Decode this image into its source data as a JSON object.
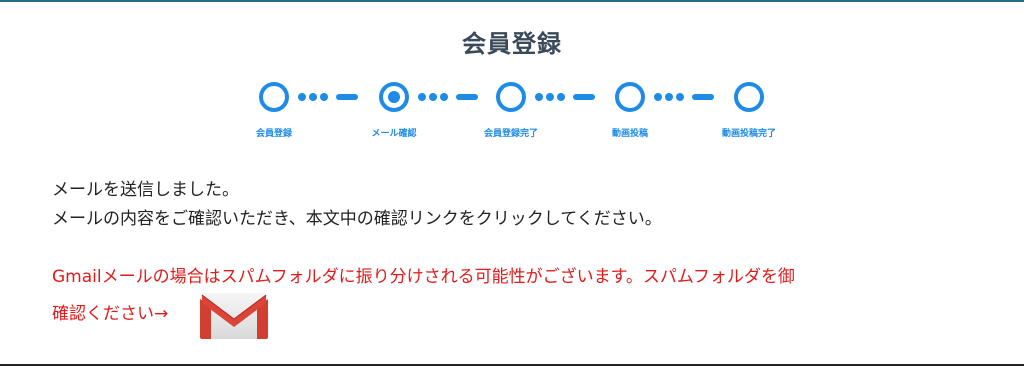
{
  "page": {
    "title": "会員登録"
  },
  "stepper": {
    "steps": [
      {
        "label": "会員登録",
        "state": "pending"
      },
      {
        "label": "メール確認",
        "state": "current"
      },
      {
        "label": "会員登録完了",
        "state": "pending"
      },
      {
        "label": "動画投稿",
        "state": "pending"
      },
      {
        "label": "動画投稿完了",
        "state": "pending"
      }
    ]
  },
  "message": {
    "line1": "メールを送信しました。",
    "line2": "メールの内容をご確認いただき、本文中の確認リンクをクリックしてください。"
  },
  "notice": {
    "line1": "Gmailメールの場合はスパムフォルダに振り分けされる可能性がございます。スパムフォルダを御",
    "line2": "確認ください→"
  },
  "icons": {
    "gmail": "gmail-icon"
  },
  "colors": {
    "accent": "#1e8be6",
    "notice": "#e01b1b",
    "title": "#3a4a5a",
    "text": "#222222"
  }
}
